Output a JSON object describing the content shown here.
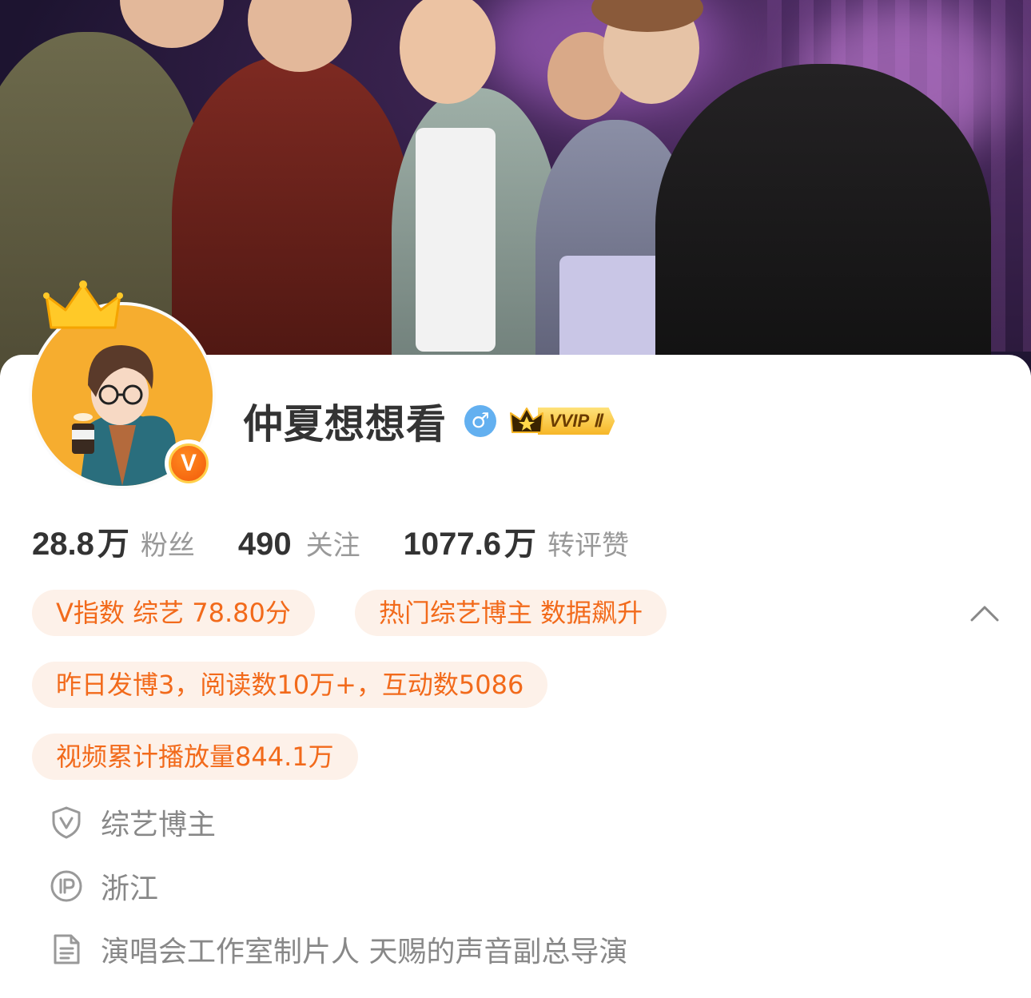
{
  "profile": {
    "name": "仲夏想想看",
    "vip_label": "VVIP Ⅱ",
    "verified_mark": "V"
  },
  "stats": [
    {
      "value": "28.8",
      "unit": "万",
      "label": "粉丝"
    },
    {
      "value": "490",
      "unit": "",
      "label": "关注"
    },
    {
      "value": "1077.6",
      "unit": "万",
      "label": "转评赞"
    }
  ],
  "tags": {
    "v_index": "V指数 综艺 78.80分",
    "hot": "热门综艺博主 数据飙升",
    "yesterday": "昨日发博3，阅读数10万+，互动数5086",
    "video": "视频累计播放量844.1万"
  },
  "info": {
    "category": "综艺博主",
    "ip_location": "浙江",
    "bio": "演唱会工作室制片人 天赐的声音副总导演"
  },
  "icons": {
    "gender": "male-icon",
    "collapse": "chevron-up-icon",
    "verified_category": "shield-v-icon",
    "ip": "ip-icon",
    "bio": "document-icon"
  },
  "colors": {
    "accent_orange": "#f26a1b",
    "tag_background": "#fdf1e9",
    "gender_blue": "#63b0f0",
    "vip_gold": "#f6b627"
  }
}
